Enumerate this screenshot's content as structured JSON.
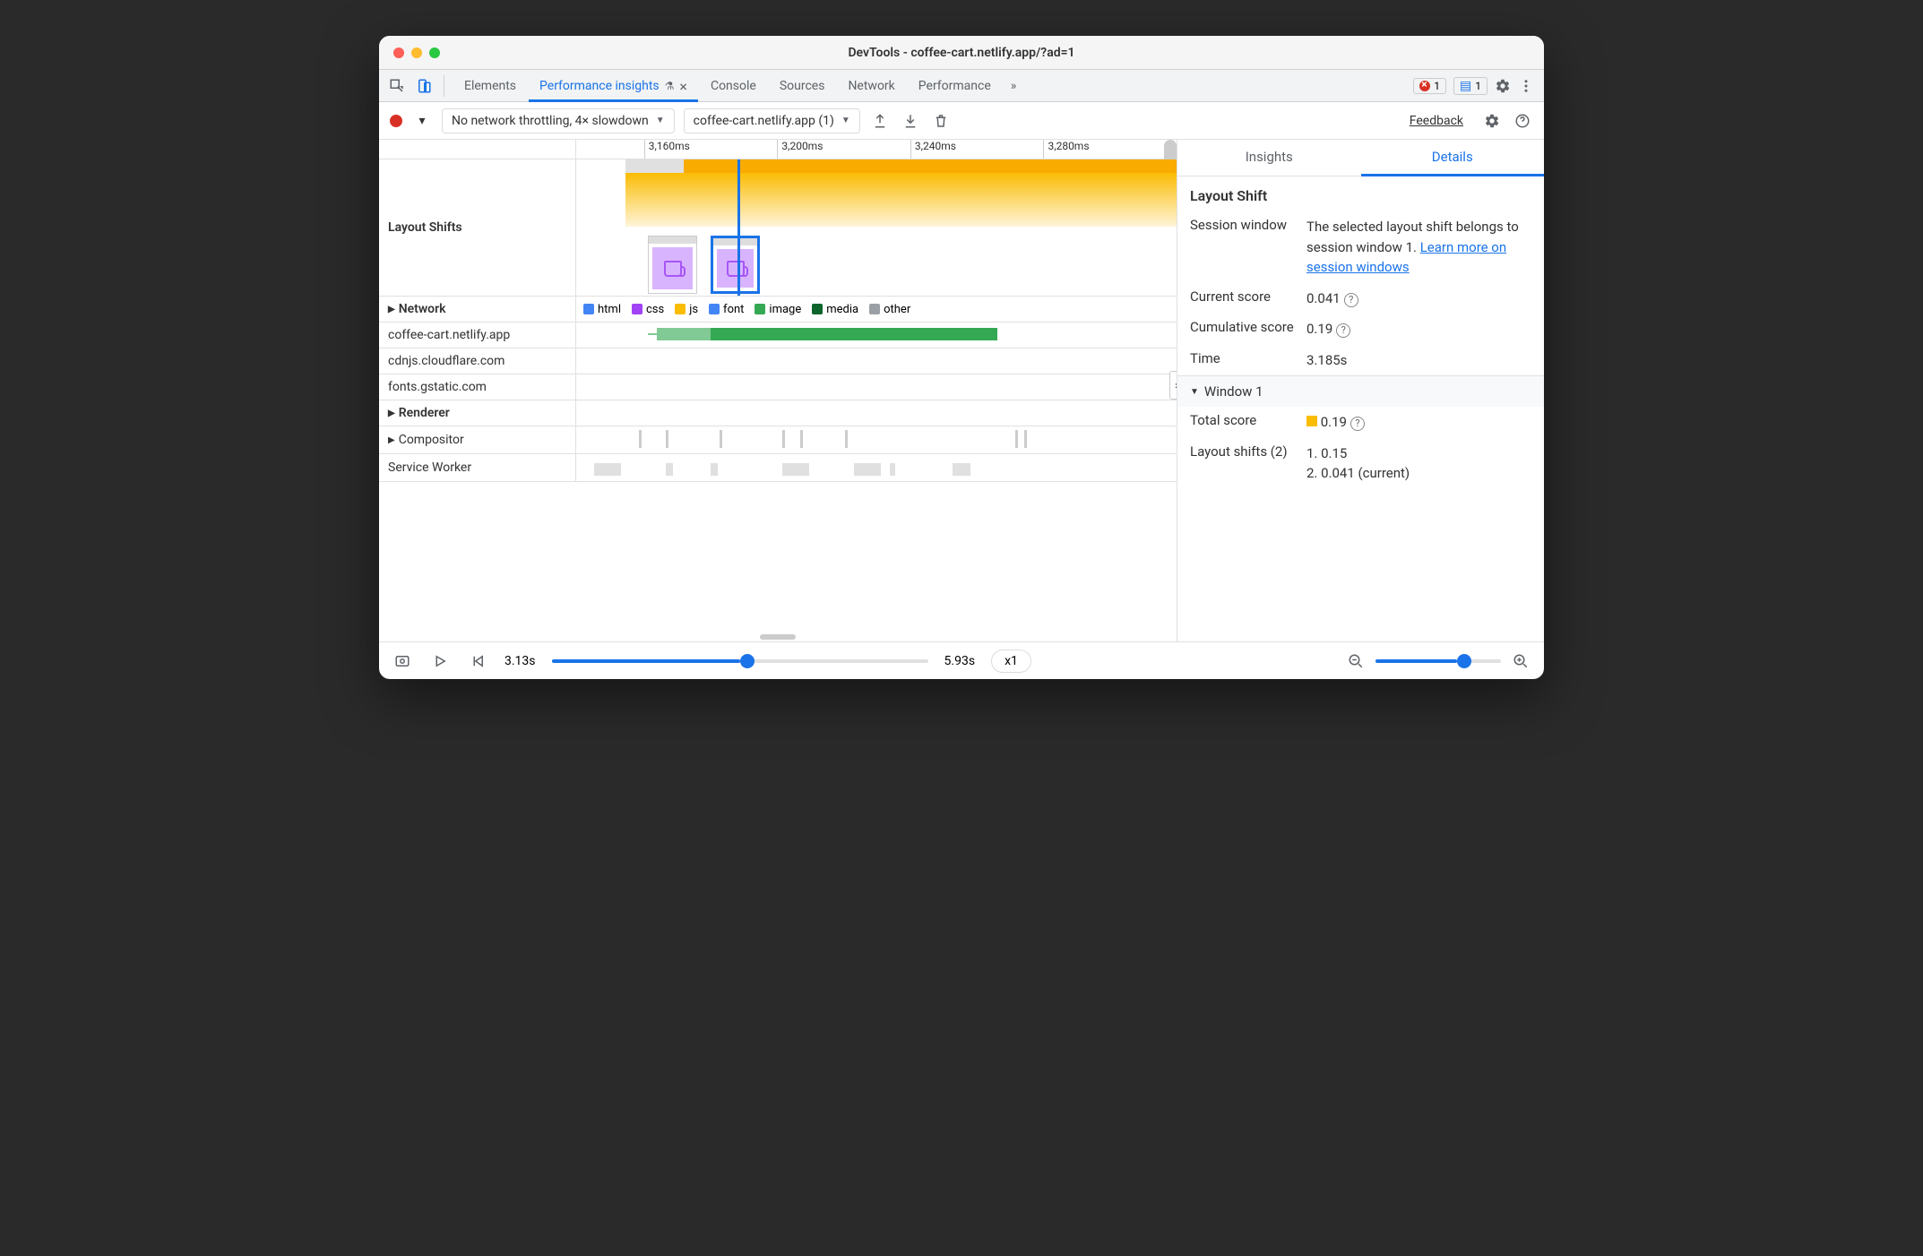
{
  "window": {
    "title": "DevTools - coffee-cart.netlify.app/?ad=1"
  },
  "tabs": {
    "items": [
      "Elements",
      "Performance insights",
      "Console",
      "Sources",
      "Network",
      "Performance"
    ],
    "active": "Performance insights",
    "errors_count": "1",
    "messages_count": "1"
  },
  "toolbar": {
    "throttling": "No network throttling, 4× slowdown",
    "recording": "coffee-cart.netlify.app (1)",
    "feedback": "Feedback"
  },
  "ruler": [
    "3,160ms",
    "3,200ms",
    "3,240ms",
    "3,280ms"
  ],
  "tracks": {
    "layout_shifts": "Layout Shifts",
    "network": "Network",
    "net_hosts": [
      "coffee-cart.netlify.app",
      "cdnjs.cloudflare.com",
      "fonts.gstatic.com"
    ],
    "renderer": "Renderer",
    "compositor": "Compositor",
    "service_worker": "Service Worker"
  },
  "legend": {
    "html": "html",
    "css": "css",
    "js": "js",
    "font": "font",
    "image": "image",
    "media": "media",
    "other": "other"
  },
  "details": {
    "tabs": {
      "insights": "Insights",
      "details": "Details"
    },
    "title": "Layout Shift",
    "session_window_label": "Session window",
    "session_window_text": "The selected layout shift belongs to session window 1. ",
    "session_window_link": "Learn more on session windows",
    "current_score_label": "Current score",
    "current_score": "0.041",
    "cumulative_label": "Cumulative score",
    "cumulative": "0.19",
    "time_label": "Time",
    "time": "3.185s",
    "window_header": "Window 1",
    "total_score_label": "Total score",
    "total_score": "0.19",
    "shifts_label": "Layout shifts (2)",
    "shift1": "1. 0.15",
    "shift2": "2. 0.041 (current)"
  },
  "footer": {
    "start": "3.13s",
    "end": "5.93s",
    "speed": "x1"
  }
}
